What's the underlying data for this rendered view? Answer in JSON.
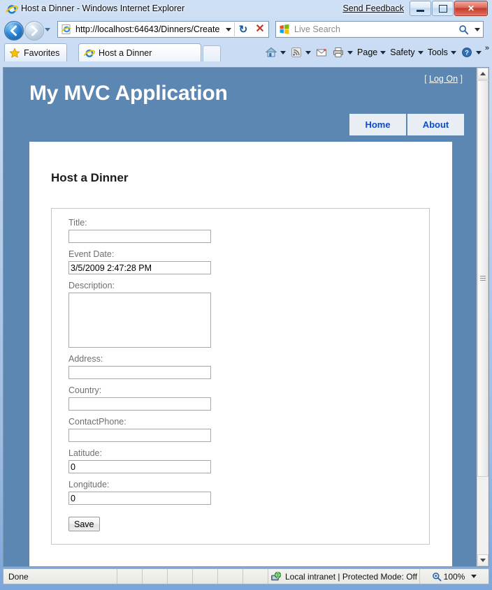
{
  "window": {
    "title": "Host a Dinner - Windows Internet Explorer",
    "send_feedback": "Send Feedback",
    "minimize_label": "Minimize",
    "maximize_label": "Maximize",
    "close_label": "Close"
  },
  "navbar": {
    "back_label": "Back",
    "forward_label": "Forward",
    "history_label": "Recent Pages",
    "url": "http://localhost:64643/Dinners/Create",
    "refresh_label": "Refresh",
    "stop_label": "Stop",
    "search_placeholder": "Live Search"
  },
  "tabbar": {
    "favorites_label": "Favorites",
    "tab_label": "Host a Dinner",
    "new_tab_label": "New Tab",
    "commands": [
      {
        "name": "home",
        "label": ""
      },
      {
        "name": "feeds",
        "label": ""
      },
      {
        "name": "read-mail",
        "label": ""
      },
      {
        "name": "print",
        "label": ""
      },
      {
        "name": "page",
        "label": "Page"
      },
      {
        "name": "safety",
        "label": "Safety"
      },
      {
        "name": "tools",
        "label": "Tools"
      },
      {
        "name": "help",
        "label": ""
      }
    ],
    "overflow": "»"
  },
  "site": {
    "title": "My MVC Application",
    "login_prefix": "[ ",
    "login_link": "Log On",
    "login_suffix": " ]",
    "menu": [
      {
        "label": "Home"
      },
      {
        "label": "About"
      }
    ],
    "accent_color": "#5c87b2",
    "link_color": "#0e4bd1"
  },
  "page_content": {
    "heading": "Host a Dinner",
    "fields": [
      {
        "name": "title",
        "label": "Title:",
        "value": "",
        "type": "text"
      },
      {
        "name": "event-date",
        "label": "Event Date:",
        "value": "3/5/2009 2:47:28 PM",
        "type": "text"
      },
      {
        "name": "description",
        "label": "Description:",
        "value": "",
        "type": "textarea"
      },
      {
        "name": "address",
        "label": "Address:",
        "value": "",
        "type": "text"
      },
      {
        "name": "country",
        "label": "Country:",
        "value": "",
        "type": "text"
      },
      {
        "name": "contact-phone",
        "label": "ContactPhone:",
        "value": "",
        "type": "text"
      },
      {
        "name": "latitude",
        "label": "Latitude:",
        "value": "0",
        "type": "text"
      },
      {
        "name": "longitude",
        "label": "Longitude:",
        "value": "0",
        "type": "text"
      }
    ],
    "save_label": "Save"
  },
  "statusbar": {
    "status": "Done",
    "zone": "Local intranet | Protected Mode: Off",
    "zoom": "100%"
  }
}
